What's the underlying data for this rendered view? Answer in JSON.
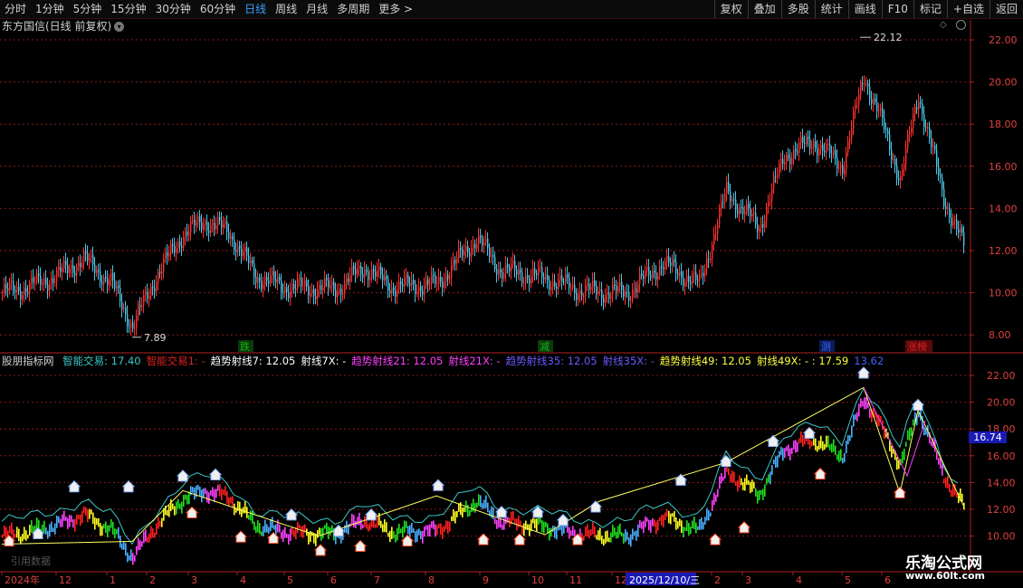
{
  "toolbar": {
    "tabs": [
      "分时",
      "1分钟",
      "5分钟",
      "15分钟",
      "30分钟",
      "60分钟",
      "日线",
      "周线",
      "月线",
      "多周期",
      "更多 >"
    ],
    "active_tab": "日线",
    "right_buttons": [
      "复权",
      "叠加",
      "多股",
      "统计",
      "画线",
      "F10",
      "标记",
      "+自选",
      "返回"
    ]
  },
  "main_chart": {
    "title": "东方国信(日线 前复权)",
    "high_label": "22.12",
    "low_label": "7.89",
    "y_ticks": [
      "22.00",
      "20.00",
      "18.00",
      "16.00",
      "14.00",
      "12.00",
      "10.00",
      "8.00"
    ],
    "markers": [
      {
        "text": "跌",
        "color": "#18b418"
      },
      {
        "text": "减",
        "color": "#18b418"
      },
      {
        "text": "测",
        "color": "#3a6aff"
      },
      {
        "text": "涨榜",
        "color": "#e02020"
      }
    ]
  },
  "indicator": {
    "name": "股朋指标网",
    "items": [
      {
        "text": "智能交易: 17.40",
        "color": "#3ac8c8"
      },
      {
        "text": "智能交易1: -",
        "color": "#e02020"
      },
      {
        "text": "趋势射线7: 12.05",
        "color": "#ffffff"
      },
      {
        "text": "射线7X: -",
        "color": "#ffffff"
      },
      {
        "text": "趋势射线21: 12.05",
        "color": "#ff40ff"
      },
      {
        "text": "射线21X: -",
        "color": "#ff40ff"
      },
      {
        "text": "趋势射线35: 12.05",
        "color": "#6a5aff"
      },
      {
        "text": "射线35X: -",
        "color": "#6a5aff"
      },
      {
        "text": "趋势射线49: 12.05",
        "color": "#ffff40"
      },
      {
        "text": "射线49X: - : 17.59",
        "color": "#ffff40"
      },
      {
        "text": "13.62",
        "color": "#4060ff"
      }
    ],
    "y_ticks": [
      "22.00",
      "20.00",
      "18.00",
      "16.00",
      "14.00",
      "12.00",
      "10.00"
    ],
    "price_tag": "16.74"
  },
  "x_axis": {
    "labels": [
      "2024年",
      "12",
      "1",
      "2",
      "3",
      "4",
      "5",
      "6",
      "7",
      "8",
      "9",
      "10",
      "11",
      "12",
      "2025/12/10/三",
      "2",
      "3",
      "4",
      "5",
      "6"
    ]
  },
  "bottom_note": "引用数据",
  "watermark": {
    "site": "乐淘公式网",
    "url": "www.60lt.com"
  },
  "colors": {
    "up": "#ff3030",
    "down": "#4ac8e8",
    "grid": "#8a1a1a",
    "axis": "#b02020"
  }
}
